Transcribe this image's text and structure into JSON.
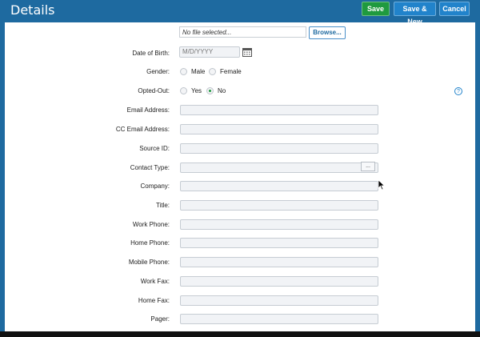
{
  "header": {
    "title": "Details",
    "save_label": "Save",
    "save_new_label": "Save & New",
    "cancel_label": "Cancel"
  },
  "file_upload": {
    "file_text": "No file selected...",
    "browse_label": "Browse..."
  },
  "dob": {
    "label": "Date of Birth:",
    "placeholder": "M/D/YYYY"
  },
  "gender": {
    "label": "Gender:",
    "options": [
      "Male",
      "Female"
    ],
    "selected": ""
  },
  "opted_out": {
    "label": "Opted-Out:",
    "options": [
      "Yes",
      "No"
    ],
    "selected": "No"
  },
  "fields": [
    {
      "label": "Email Address:",
      "value": ""
    },
    {
      "label": "CC Email Address:",
      "value": ""
    },
    {
      "label": "Source ID:",
      "value": ""
    },
    {
      "label": "Contact Type:",
      "value": "",
      "lookup": "..."
    },
    {
      "label": "Company:",
      "value": ""
    },
    {
      "label": "Title:",
      "value": ""
    },
    {
      "label": "Work Phone:",
      "value": ""
    },
    {
      "label": "Home Phone:",
      "value": ""
    },
    {
      "label": "Mobile Phone:",
      "value": ""
    },
    {
      "label": "Work Fax:",
      "value": ""
    },
    {
      "label": "Home Fax:",
      "value": ""
    },
    {
      "label": "Pager:",
      "value": ""
    }
  ],
  "help": {
    "icon": "help-icon",
    "glyph": "?"
  },
  "colors": {
    "header": "#1e6aa0",
    "save": "#1f9a3f",
    "primary": "#2183cb"
  }
}
